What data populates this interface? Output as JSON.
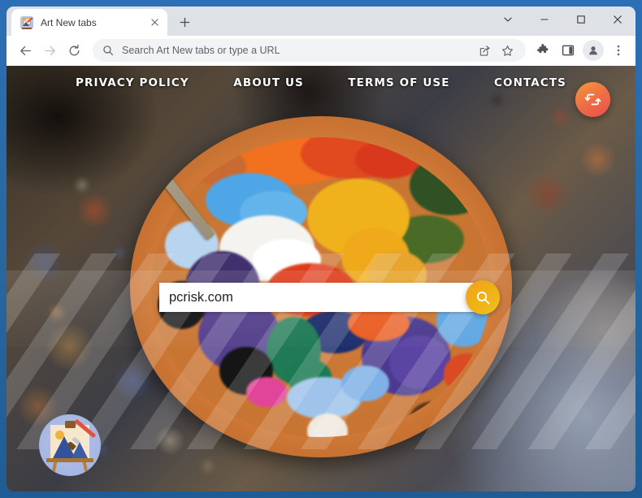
{
  "browser": {
    "window_controls": [
      {
        "name": "tab-search",
        "icon": "chevron-down-icon"
      },
      {
        "name": "minimize",
        "icon": "minimize-icon"
      },
      {
        "name": "maximize",
        "icon": "maximize-icon"
      },
      {
        "name": "close",
        "icon": "close-icon"
      }
    ],
    "tab": {
      "title": "Art New tabs",
      "favicon": "art-easel-favicon",
      "close_label": "×"
    },
    "new_tab_label": "+",
    "nav": {
      "back": "back-arrow-icon",
      "forward": "forward-arrow-icon",
      "reload": "reload-icon"
    },
    "omnibox": {
      "placeholder": "Search Art New tabs or type a URL",
      "value": "",
      "search_icon": "search-icon",
      "share_icon": "share-icon",
      "bookmark_icon": "star-icon"
    },
    "toolbar_right": {
      "extensions_icon": "puzzle-icon",
      "side_panel_icon": "side-panel-icon",
      "profile_icon": "profile-avatar-icon",
      "menu_icon": "three-dot-menu-icon"
    }
  },
  "page": {
    "nav_links": [
      {
        "label": "PRIVACY POLICY"
      },
      {
        "label": "ABOUT US"
      },
      {
        "label": "TERMS OF USE"
      },
      {
        "label": "CONTACTS"
      }
    ],
    "refresh_button": {
      "icon": "refresh-arrows-icon"
    },
    "search": {
      "value": "pcrisk.com",
      "placeholder": "",
      "button_icon": "search-icon"
    },
    "logo": {
      "name": "art-easel-logo"
    },
    "background": {
      "description": "paint-palette-photo"
    }
  },
  "colors": {
    "window_border": "#2a6db5",
    "tabstrip": "#dee1e6",
    "toolbar": "#ffffff",
    "omnibox": "#f1f3f4",
    "refresh_fab_start": "#f59a3c",
    "refresh_fab_end": "#e84f4f",
    "search_btn_start": "#f2a01f",
    "search_btn_end": "#f3c11a",
    "palette_rim": "#cf7836",
    "nav_text": "#ffffff"
  }
}
